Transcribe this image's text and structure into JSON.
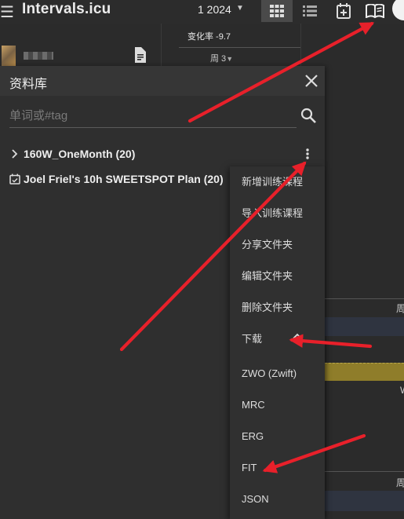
{
  "app": {
    "title": "Intervals.icu"
  },
  "toolbar": {
    "date": "1 2024"
  },
  "background": {
    "rate_text": "变化率 -9.7",
    "week_label": "周 3",
    "week_label_2": "周",
    "week_label_3": "周",
    "w_label": "W"
  },
  "library": {
    "title": "资料库",
    "search_placeholder": "单词或#tag",
    "folders": [
      {
        "label": "160W_OneMonth (20)"
      },
      {
        "label": "Joel Friel's 10h SWEETSPOT Plan (20)"
      }
    ]
  },
  "menu": {
    "items": [
      "新增训练课程",
      "导入训练课程",
      "分享文件夹",
      "编辑文件夹",
      "删除文件夹",
      "下载",
      "ZWO (Zwift)",
      "MRC",
      "ERG",
      "FIT",
      "JSON"
    ]
  },
  "colors": {
    "arrow": "#e8202a",
    "panel": "#2f2f2f"
  }
}
